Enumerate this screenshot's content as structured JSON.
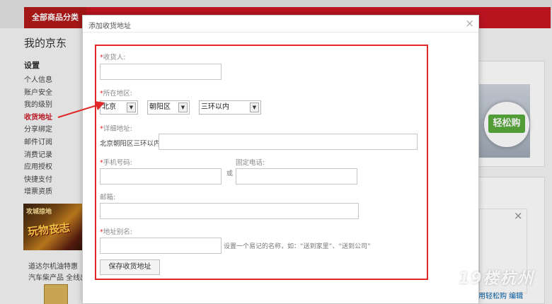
{
  "header": {
    "all_categories": "全部商品分类"
  },
  "page": {
    "title": "我的京东"
  },
  "sidebar": {
    "section_title": "设置",
    "items": [
      {
        "label": "个人信息"
      },
      {
        "label": "账户安全"
      },
      {
        "label": "我的级别"
      },
      {
        "label": "收货地址",
        "active": true
      },
      {
        "label": "分享绑定"
      },
      {
        "label": "邮件订阅"
      },
      {
        "label": "消费记录"
      },
      {
        "label": "应用授权"
      },
      {
        "label": "快捷支付"
      },
      {
        "label": "增票资质"
      }
    ]
  },
  "ad": {
    "banner_top": "攻城掠地",
    "banner_main": "玩物丧志",
    "promo_line1": "道达尔机油特惠",
    "promo_line2": "汽车柴产品 全线出击"
  },
  "right": {
    "easybuy_label": "轻松购",
    "bottom_link": "用轻松购 编辑",
    "watermark": "19楼杭州"
  },
  "dialog": {
    "title": "添加收货地址",
    "close_glyph": "×",
    "form": {
      "consignee_label": "收货人:",
      "region_label": "所在地区:",
      "province": "北京",
      "city": "朝阳区",
      "district": "三环以内",
      "detail_label": "详细地址:",
      "detail_prefix": "北京朝阳区三环以内",
      "mobile_label": "手机号码:",
      "or_text": "或",
      "phone_label": "固定电话:",
      "email_label": "邮箱:",
      "alias_label": "地址别名:",
      "alias_hint": "设置一个易记的名称，如：“送到家里”、“送到公司”",
      "save_label": "保存收货地址",
      "required_mark": "*"
    }
  },
  "colors": {
    "brand_red": "#c81623",
    "highlight_red": "#e02828",
    "easybuy_green": "#5aaa3c"
  }
}
